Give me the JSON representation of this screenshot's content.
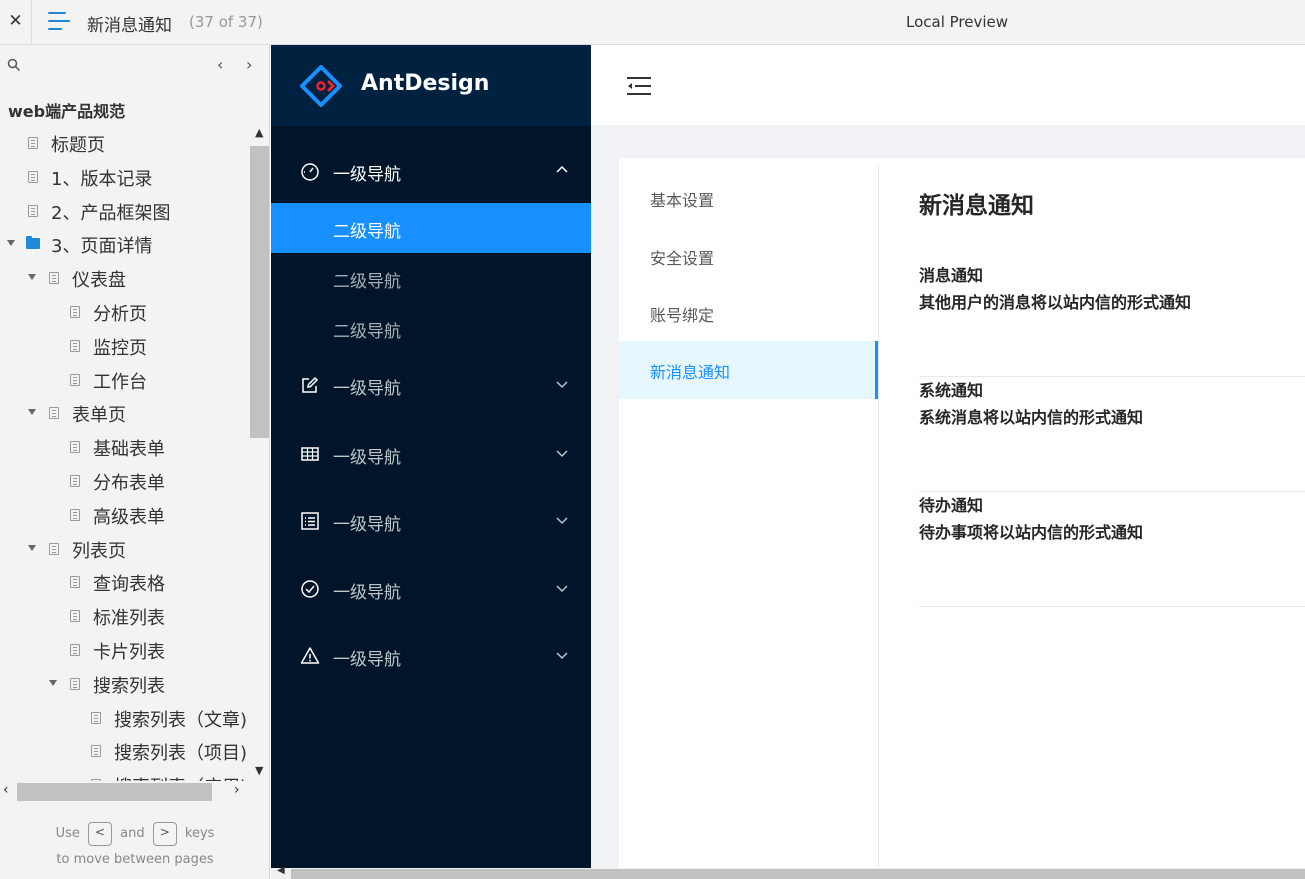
{
  "topbar": {
    "close_label": "✕",
    "page_title": "新消息通知",
    "page_count": "(37 of 37)",
    "preview_label": "Local Preview"
  },
  "sitemap": {
    "project_title": "web端产品规范",
    "prev_label": "‹",
    "next_label": "›",
    "items": [
      {
        "label": "标题页",
        "type": "page",
        "depth": 0,
        "expanded": false
      },
      {
        "label": "1、版本记录",
        "type": "page",
        "depth": 0,
        "expanded": false
      },
      {
        "label": "2、产品框架图",
        "type": "page",
        "depth": 0,
        "expanded": false
      },
      {
        "label": "3、页面详情",
        "type": "folder",
        "depth": 0,
        "expanded": true
      },
      {
        "label": "仪表盘",
        "type": "page",
        "depth": 1,
        "expanded": true
      },
      {
        "label": "分析页",
        "type": "page",
        "depth": 2,
        "expanded": false
      },
      {
        "label": "监控页",
        "type": "page",
        "depth": 2,
        "expanded": false
      },
      {
        "label": "工作台",
        "type": "page",
        "depth": 2,
        "expanded": false
      },
      {
        "label": "表单页",
        "type": "page",
        "depth": 1,
        "expanded": true
      },
      {
        "label": "基础表单",
        "type": "page",
        "depth": 2,
        "expanded": false
      },
      {
        "label": "分布表单",
        "type": "page",
        "depth": 2,
        "expanded": false
      },
      {
        "label": "高级表单",
        "type": "page",
        "depth": 2,
        "expanded": false
      },
      {
        "label": "列表页",
        "type": "page",
        "depth": 1,
        "expanded": true
      },
      {
        "label": "查询表格",
        "type": "page",
        "depth": 2,
        "expanded": false
      },
      {
        "label": "标准列表",
        "type": "page",
        "depth": 2,
        "expanded": false
      },
      {
        "label": "卡片列表",
        "type": "page",
        "depth": 2,
        "expanded": false
      },
      {
        "label": "搜索列表",
        "type": "page",
        "depth": 2,
        "expanded": true
      },
      {
        "label": "搜索列表（文章)",
        "type": "page",
        "depth": 3,
        "expanded": false
      },
      {
        "label": "搜索列表（项目)",
        "type": "page",
        "depth": 3,
        "expanded": false
      },
      {
        "label": "搜索列表（应用)",
        "type": "page",
        "depth": 3,
        "expanded": false
      }
    ],
    "hint": {
      "use": "Use",
      "and": "and",
      "keys": "keys",
      "line2": "to move between pages",
      "key_prev": "<",
      "key_next": ">"
    }
  },
  "app": {
    "brand": "AntDesign",
    "nav": [
      {
        "label": "一级导航",
        "icon": "dashboard-icon",
        "expanded": true,
        "children": [
          {
            "label": "二级导航",
            "active": true
          },
          {
            "label": "二级导航",
            "active": false
          },
          {
            "label": "二级导航",
            "active": false
          }
        ]
      },
      {
        "label": "一级导航",
        "icon": "edit-icon",
        "expanded": false
      },
      {
        "label": "一级导航",
        "icon": "table-icon",
        "expanded": false
      },
      {
        "label": "一级导航",
        "icon": "profile-icon",
        "expanded": false
      },
      {
        "label": "一级导航",
        "icon": "check-circle-icon",
        "expanded": false
      },
      {
        "label": "一级导航",
        "icon": "warning-icon",
        "expanded": false
      }
    ],
    "settings_menu": [
      {
        "label": "基本设置",
        "active": false
      },
      {
        "label": "安全设置",
        "active": false
      },
      {
        "label": "账号绑定",
        "active": false
      },
      {
        "label": "新消息通知",
        "active": true
      }
    ],
    "content": {
      "title": "新消息通知",
      "notifications": [
        {
          "title": "消息通知",
          "desc": "其他用户的消息将以站内信的形式通知"
        },
        {
          "title": "系统通知",
          "desc": "系统消息将以站内信的形式通知"
        },
        {
          "title": "待办通知",
          "desc": "待办事项将以站内信的形式通知"
        }
      ]
    }
  },
  "colors": {
    "sidebar_bg": "#001529",
    "logo_bg": "#002140",
    "primary": "#1890ff",
    "menu_active_bg": "#e6f7ff",
    "page_bg": "#f0f2f5",
    "logo_accent": "#f5222d"
  }
}
